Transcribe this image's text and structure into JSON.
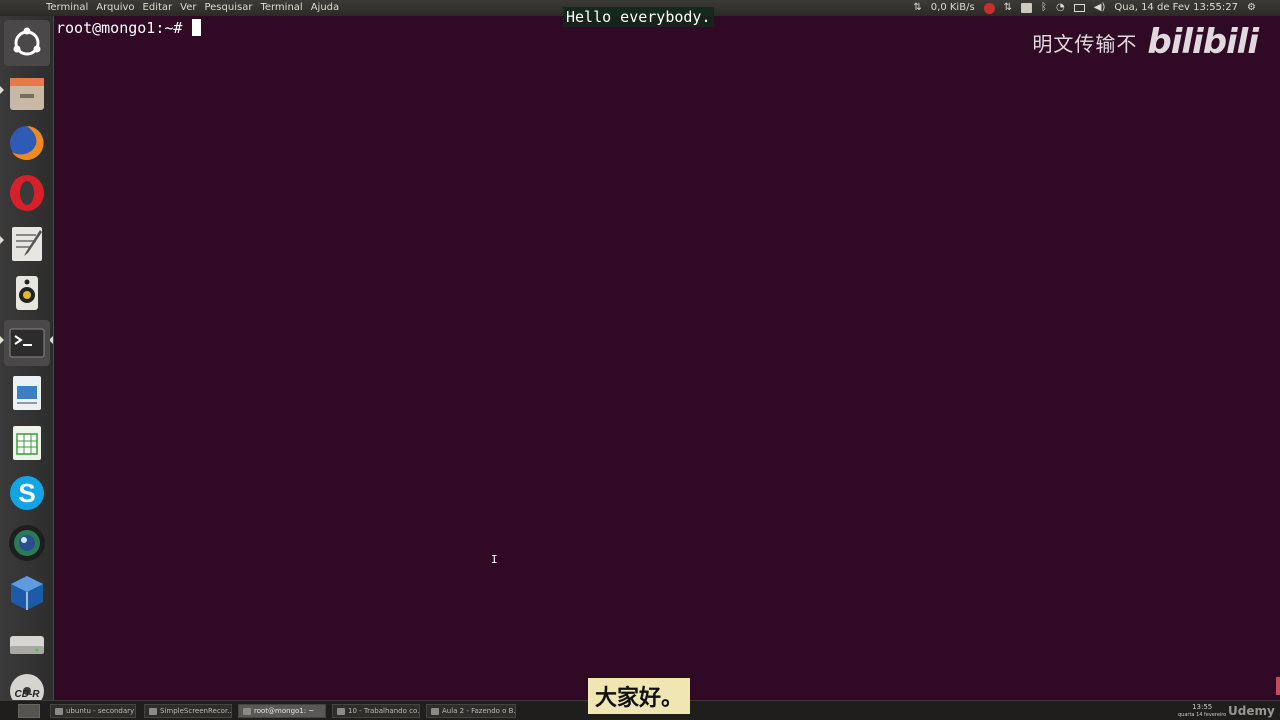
{
  "top_panel": {
    "menu": [
      "Terminal",
      "Arquivo",
      "Editar",
      "Ver",
      "Pesquisar",
      "Terminal",
      "Ajuda"
    ],
    "net_speed": "0,0 KiB/s",
    "datetime": "Qua, 14 de Fev 13:55:27"
  },
  "terminal": {
    "prompt": "root@mongo1:~# "
  },
  "subtitle_en": "Hello everybody.",
  "subtitle_cn": "大家好。",
  "watermark": {
    "text": "明文传输不",
    "logo": "bilibili"
  },
  "launcher": {
    "items": [
      {
        "name": "ubuntu-dash-icon"
      },
      {
        "name": "files-icon"
      },
      {
        "name": "firefox-icon"
      },
      {
        "name": "opera-icon"
      },
      {
        "name": "text-editor-icon"
      },
      {
        "name": "rhythmbox-icon"
      },
      {
        "name": "terminal-icon"
      },
      {
        "name": "libreoffice-impress-icon"
      },
      {
        "name": "libreoffice-calc-icon"
      },
      {
        "name": "skype-icon"
      },
      {
        "name": "camera-app-icon"
      },
      {
        "name": "virtualbox-icon"
      },
      {
        "name": "drive-icon"
      },
      {
        "name": "cd-r-icon"
      }
    ],
    "cd_label": "CD-R"
  },
  "taskbar": {
    "tasks": [
      "ubuntu - secondary ...",
      "SimpleScreenRecor...",
      "root@mongo1: ~",
      "10 - Trabalhando co...",
      "Aula 2 - Fazendo o B..."
    ],
    "active_index": 2,
    "clock_time": "13:55",
    "clock_date": "quarta 14 fevereiro",
    "brand": "Udemy"
  }
}
